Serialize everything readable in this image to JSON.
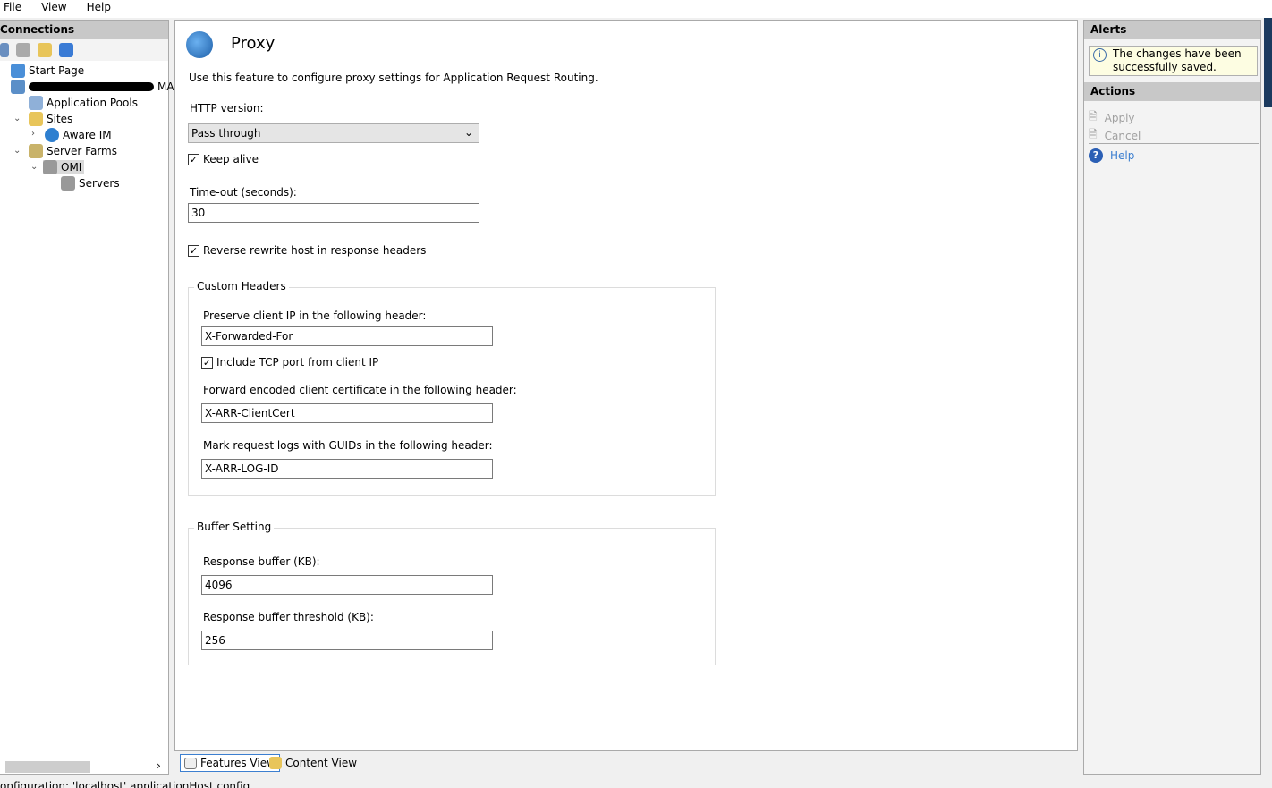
{
  "menu": [
    "File",
    "View",
    "Help"
  ],
  "connections": {
    "title": "Connections",
    "tree": {
      "start_page": "Start Page",
      "server": "MA",
      "app_pools": "Application Pools",
      "sites": "Sites",
      "aware_im": "Aware IM",
      "server_farms": "Server Farms",
      "omi": "OMI",
      "servers": "Servers"
    }
  },
  "main": {
    "title": "Proxy",
    "description": "Use this feature to configure proxy settings for Application Request Routing.",
    "http_version_label": "HTTP version:",
    "http_version_value": "Pass through",
    "keep_alive": {
      "label": "Keep alive",
      "checked": true
    },
    "timeout_label": "Time-out (seconds):",
    "timeout_value": "30",
    "reverse_rewrite": {
      "label": "Reverse rewrite host in response headers",
      "checked": true
    },
    "custom_headers": {
      "title": "Custom Headers",
      "preserve_label": "Preserve client IP in the following header:",
      "preserve_value": "X-Forwarded-For",
      "include_tcp": {
        "label": "Include TCP port from client IP",
        "checked": true
      },
      "cert_label": "Forward encoded client certificate in the following header:",
      "cert_value": "X-ARR-ClientCert",
      "guid_label": "Mark request logs with GUIDs in the following header:",
      "guid_value": "X-ARR-LOG-ID"
    },
    "buffer": {
      "title": "Buffer Setting",
      "response_label": "Response buffer (KB):",
      "response_value": "4096",
      "threshold_label": "Response buffer threshold (KB):",
      "threshold_value": "256"
    }
  },
  "views": {
    "features": "Features View",
    "content": "Content View"
  },
  "alerts": {
    "title": "Alerts",
    "message": "The changes have been successfully saved."
  },
  "actions": {
    "title": "Actions",
    "apply": "Apply",
    "cancel": "Cancel",
    "help": "Help"
  },
  "status": "onfiguration: 'localhost' applicationHost.config"
}
